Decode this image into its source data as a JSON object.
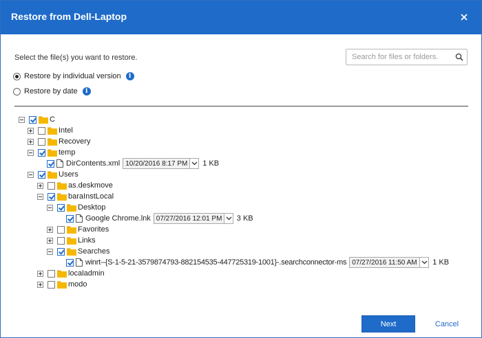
{
  "dialog": {
    "title": "Restore from Dell-Laptop",
    "instructions": "Select the file(s) you want to restore.",
    "search_placeholder": "Search for files or folders.",
    "options": [
      {
        "label": "Restore by individual version",
        "selected": true
      },
      {
        "label": "Restore by date",
        "selected": false
      }
    ],
    "info_glyph": "i"
  },
  "tree": {
    "c": {
      "label": "C",
      "expander": "minus",
      "checked": true
    },
    "intel": {
      "label": "Intel",
      "expander": "plus",
      "checked": false
    },
    "recovery": {
      "label": "Recovery",
      "expander": "plus",
      "checked": false
    },
    "temp": {
      "label": "temp",
      "expander": "minus",
      "checked": true
    },
    "dircontents": {
      "label": "DirContents.xml",
      "version": "10/20/2016 8:17 PM",
      "size": "1 KB",
      "checked": true
    },
    "users": {
      "label": "Users",
      "expander": "minus",
      "checked": true
    },
    "asdeskmove": {
      "label": "as.deskmove",
      "expander": "plus",
      "checked": false
    },
    "barainstlocal": {
      "label": "baraInstLocal",
      "expander": "minus",
      "checked": true
    },
    "desktop": {
      "label": "Desktop",
      "expander": "minus",
      "checked": true
    },
    "chrome": {
      "label": "Google Chrome.lnk",
      "version": "07/27/2016 12:01 PM",
      "size": "3 KB",
      "checked": true
    },
    "favorites": {
      "label": "Favorites",
      "expander": "plus",
      "checked": false
    },
    "links": {
      "label": "Links",
      "expander": "plus",
      "checked": false
    },
    "searches": {
      "label": "Searches",
      "expander": "minus",
      "checked": true
    },
    "winrt": {
      "label": "winrt--{S-1-5-21-3579874793-882154535-447725319-1001}-.searchconnector-ms",
      "version": "07/27/2016 11:50 AM",
      "size": "1 KB",
      "checked": true
    },
    "localadmin": {
      "label": "localadmin",
      "expander": "plus",
      "checked": false
    },
    "modo": {
      "label": "modo",
      "expander": "plus",
      "checked": false
    }
  },
  "footer": {
    "next_label": "Next",
    "cancel_label": "Cancel"
  },
  "colors": {
    "accent": "#1e6bc9",
    "folder": "#f5b800"
  },
  "icons": {
    "close": "close-icon",
    "search": "search-icon",
    "info": "info-icon",
    "folder": "folder-icon",
    "file": "file-icon"
  }
}
